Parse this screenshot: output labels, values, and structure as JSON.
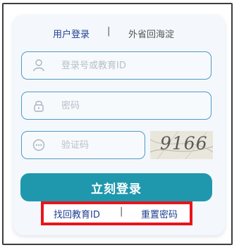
{
  "tabs": {
    "login": "用户登录",
    "separator": "|",
    "other": "外省回海淀"
  },
  "fields": {
    "account_placeholder": "登录号或教育ID",
    "password_placeholder": "密码",
    "captcha_placeholder": "验证码"
  },
  "captcha": {
    "text": "9166"
  },
  "login_button": "立刻登录",
  "links": {
    "find_id": "找回教育ID",
    "separator": "|",
    "reset_password": "重置密码"
  },
  "colors": {
    "accent": "#1f98ad",
    "highlight_border": "#e8141b",
    "field_border": "#4e9ac6"
  },
  "icons": {
    "account": "user-icon",
    "password": "lock-icon",
    "captcha": "ellipsis-icon"
  }
}
